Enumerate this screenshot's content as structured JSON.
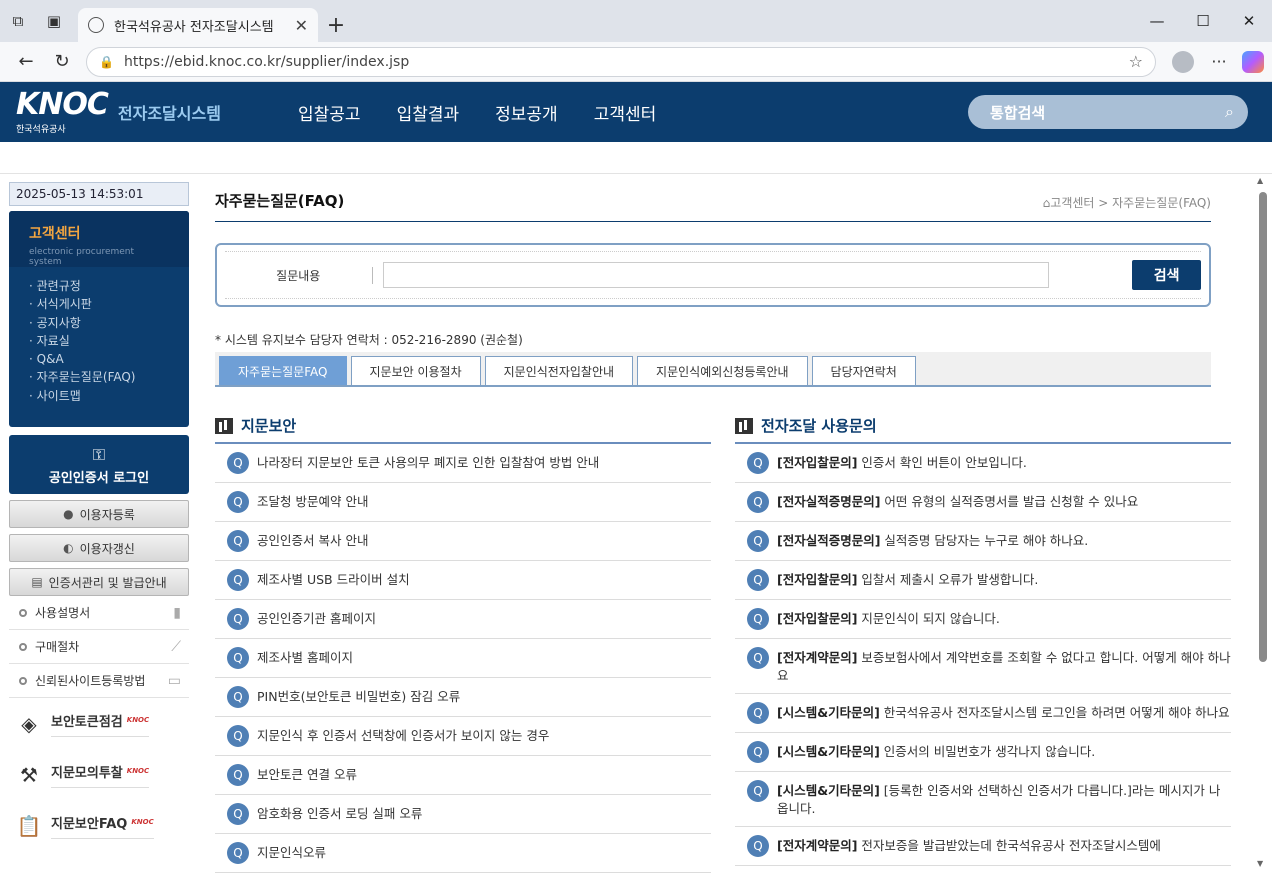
{
  "browser": {
    "tab_title": "한국석유공사 전자조달시스템",
    "url": "https://ebid.knoc.co.kr/supplier/index.jsp"
  },
  "header": {
    "logo_mark": "KNOC",
    "logo_sub": "한국석유공사",
    "system_title": "전자조달시스템",
    "nav": [
      "입찰공고",
      "입찰결과",
      "정보공개",
      "고객센터"
    ],
    "search_label": "통합검색"
  },
  "sidebar": {
    "datetime": "2025-05-13 14:53:01",
    "section_title": "고객센터",
    "section_sub": "electronic procurement system",
    "items": [
      "관련규정",
      "서식게시판",
      "공지사항",
      "자료실",
      "Q&A",
      "자주묻는질문(FAQ)",
      "사이트맵"
    ],
    "cert_login": "공인인증서 로그인",
    "buttons": [
      "이용자등록",
      "이용자갱신",
      "인증서관리 및 발급안내"
    ],
    "links": [
      "사용설명서",
      "구매절차",
      "신뢰된사이트등록방법"
    ],
    "big_links": [
      "보안토큰점검",
      "지문모의투찰",
      "지문보안FAQ"
    ],
    "brand_tag": "KNOC"
  },
  "content": {
    "page_title": "자주묻는질문(FAQ)",
    "breadcrumb": "고객센터 > 자주묻는질문(FAQ)",
    "search_label": "질문내용",
    "search_button": "검색",
    "notice": "* 시스템 유지보수 담당자 연락처 : 052-216-2890 (권순철)",
    "tabs": [
      "자주묻는질문FAQ",
      "지문보안 이용절차",
      "지문인식전자입찰안내",
      "지문인식예외신청등록안내",
      "담당자연락처"
    ],
    "left_title": "지문보안",
    "left_items": [
      "나라장터 지문보안 토큰 사용의무 폐지로 인한 입찰참여 방법 안내",
      "조달청 방문예약 안내",
      "공인인증서 복사 안내",
      "제조사별 USB 드라이버 설치",
      "공인인증기관 홈페이지",
      "제조사별 홈페이지",
      "PIN번호(보안토큰 비밀번호) 잠김 오류",
      "지문인식 후 인증서 선택창에 인증서가 보이지 않는 경우",
      "보안토큰 연결 오류",
      "암호화용 인증서 로딩 실패 오류",
      "지문인식오류"
    ],
    "right_title": "전자조달 사용문의",
    "right_items": [
      {
        "cat": "[전자입찰문의]",
        "text": " 인증서 확인 버튼이 안보입니다."
      },
      {
        "cat": "[전자실적증명문의]",
        "text": " 어떤 유형의 실적증명서를 발급 신청할 수 있나요"
      },
      {
        "cat": "[전자실적증명문의]",
        "text": " 실적증명 담당자는 누구로 해야 하나요."
      },
      {
        "cat": "[전자입찰문의]",
        "text": " 입찰서 제출시 오류가 발생합니다."
      },
      {
        "cat": "[전자입찰문의]",
        "text": " 지문인식이 되지 않습니다."
      },
      {
        "cat": "[전자계약문의]",
        "text": " 보증보험사에서 계약번호를 조회할 수 없다고 합니다. 어떻게 해야 하나요"
      },
      {
        "cat": "[시스템&기타문의]",
        "text": " 한국석유공사 전자조달시스템 로그인을 하려면 어떻게 해야 하나요"
      },
      {
        "cat": "[시스템&기타문의]",
        "text": " 인증서의 비밀번호가 생각나지 않습니다."
      },
      {
        "cat": "[시스템&기타문의]",
        "text": " [등록한 인증서와 선택하신 인증서가 다릅니다.]라는 메시지가 나옵니다."
      },
      {
        "cat": "[전자계약문의]",
        "text": " 전자보증을 발급받았는데 한국석유공사 전자조달시스템에"
      }
    ]
  }
}
